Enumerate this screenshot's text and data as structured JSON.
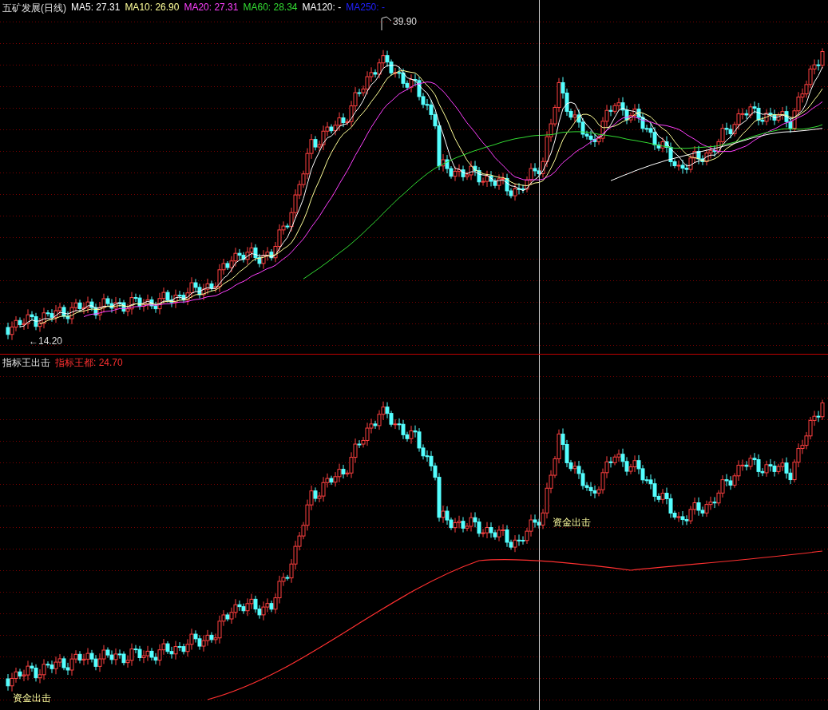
{
  "price_panel": {
    "title": "五矿发展(日线)",
    "indicators": [
      {
        "label": "MA5: 27.31",
        "color": "#ffffff"
      },
      {
        "label": "MA10: 26.90",
        "color": "#ffff99"
      },
      {
        "label": "MA20: 27.31",
        "color": "#ff40ff"
      },
      {
        "label": "MA60: 28.34",
        "color": "#33dd33"
      },
      {
        "label": "MA120: -",
        "color": "#ffffff"
      },
      {
        "label": "MA250: -",
        "color": "#2020ff"
      }
    ],
    "high_label": "39.90",
    "low_label": "←14.20"
  },
  "indicator_panel": {
    "title": "指标王出击",
    "indicators": [
      {
        "label": "指标王都: 24.70",
        "color": "#ff3030"
      }
    ],
    "signals": [
      "资金出击",
      "资金出击"
    ]
  }
}
